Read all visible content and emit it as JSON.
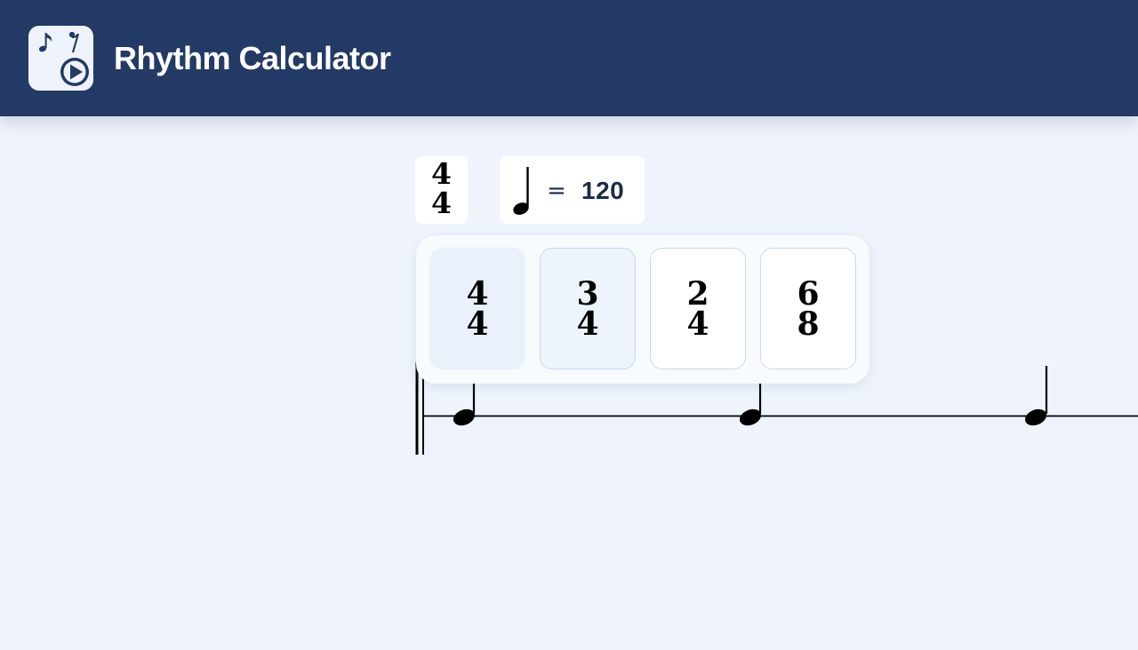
{
  "app": {
    "title": "Rhythm Calculator",
    "icon": "music-notes-play-icon"
  },
  "toolbar": {
    "time_signature": {
      "top": "4",
      "bottom": "4"
    },
    "tempo": {
      "note": "quarter-note-icon",
      "equals": "=",
      "bpm": "120"
    }
  },
  "time_signature_menu": {
    "options": [
      {
        "top": "4",
        "bottom": "4",
        "selected": true
      },
      {
        "top": "3",
        "bottom": "4",
        "selected": false
      },
      {
        "top": "2",
        "bottom": "4",
        "selected": false
      },
      {
        "top": "6",
        "bottom": "8",
        "selected": false
      }
    ]
  },
  "score": {
    "notes": [
      "quarter-note",
      "quarter-note",
      "quarter-note"
    ]
  },
  "colors": {
    "header": "#233a66",
    "background": "#eff4fc",
    "border": "#c8d8ea"
  }
}
